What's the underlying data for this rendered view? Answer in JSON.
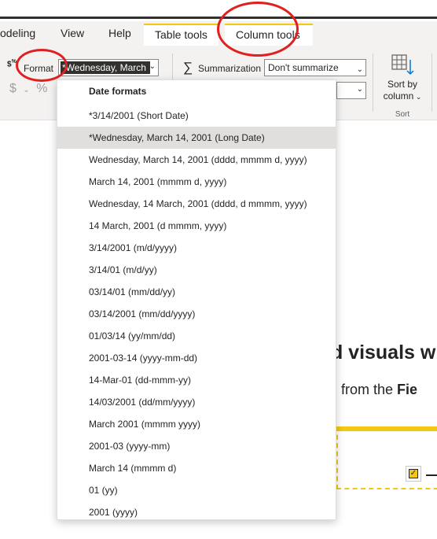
{
  "tabs": {
    "modeling": "odeling",
    "view": "View",
    "help": "Help",
    "table_tools": "Table tools",
    "column_tools": "Column tools"
  },
  "format": {
    "label": "Format",
    "selected_value": "*Wednesday, March",
    "currency_symbol": "$",
    "percent_symbol": "%",
    "comma_symbol": "’"
  },
  "summarization": {
    "label": "Summarization",
    "value": "Don't summarize"
  },
  "sort": {
    "label_line1": "Sort by",
    "label_line2": "column",
    "group_label": "Sort"
  },
  "dropdown": {
    "header": "Date formats",
    "items": [
      "*3/14/2001 (Short Date)",
      "*Wednesday, March 14, 2001 (Long Date)",
      "Wednesday, March 14, 2001 (dddd, mmmm d, yyyy)",
      "March 14, 2001 (mmmm d, yyyy)",
      "Wednesday, 14 March, 2001 (dddd, d mmmm, yyyy)",
      "14 March, 2001 (d mmmm, yyyy)",
      "3/14/2001 (m/d/yyyy)",
      "3/14/01 (m/d/yy)",
      "03/14/01 (mm/dd/yy)",
      "03/14/2001 (mm/dd/yyyy)",
      "01/03/14 (yy/mm/dd)",
      "2001-03-14 (yyyy-mm-dd)",
      "14-Mar-01 (dd-mmm-yy)",
      "14/03/2001 (dd/mm/yyyy)",
      "March 2001 (mmmm yyyy)",
      "2001-03 (yyyy-mm)",
      "March 14 (mmmm d)",
      "01 (yy)",
      "2001 (yyyy)"
    ],
    "selected_index": 1
  },
  "background": {
    "heading": "ld visuals w",
    "sub_prefix": "from the ",
    "sub_bold": "Fie"
  },
  "colors": {
    "accent": "#f2c811",
    "annotation": "#e02020",
    "selected_bg": "#e1dfdd"
  },
  "icons": {
    "format": "currency-format-icon",
    "summarization": "sigma-icon",
    "sort": "sort-by-column-icon",
    "chevron": "chevron-down-icon"
  }
}
